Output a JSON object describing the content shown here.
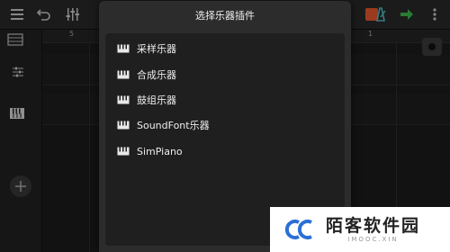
{
  "dialog": {
    "title": "选择乐器插件",
    "items": [
      {
        "label": "采样乐器"
      },
      {
        "label": "合成乐器"
      },
      {
        "label": "鼓组乐器"
      },
      {
        "label": "SoundFont乐器"
      },
      {
        "label": "SimPiano"
      }
    ]
  },
  "ruler": {
    "marks": [
      "5",
      "1"
    ]
  },
  "watermark": {
    "name": "陌客软件园",
    "sub": "IMOOC.XIN"
  },
  "colors": {
    "accent_record": "#f05a32",
    "accent_next": "#3fbf4f",
    "metronome": "#53c0c8"
  }
}
